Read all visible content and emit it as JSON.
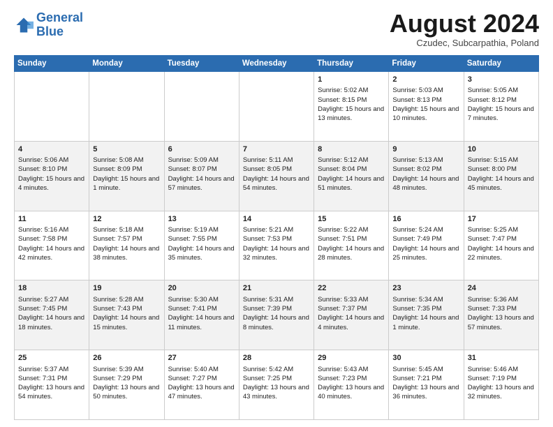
{
  "header": {
    "logo_line1": "General",
    "logo_line2": "Blue",
    "month": "August 2024",
    "location": "Czudec, Subcarpathia, Poland"
  },
  "days_of_week": [
    "Sunday",
    "Monday",
    "Tuesday",
    "Wednesday",
    "Thursday",
    "Friday",
    "Saturday"
  ],
  "weeks": [
    [
      {
        "day": "",
        "sunrise": "",
        "sunset": "",
        "daylight": ""
      },
      {
        "day": "",
        "sunrise": "",
        "sunset": "",
        "daylight": ""
      },
      {
        "day": "",
        "sunrise": "",
        "sunset": "",
        "daylight": ""
      },
      {
        "day": "",
        "sunrise": "",
        "sunset": "",
        "daylight": ""
      },
      {
        "day": "1",
        "sunrise": "Sunrise: 5:02 AM",
        "sunset": "Sunset: 8:15 PM",
        "daylight": "Daylight: 15 hours and 13 minutes."
      },
      {
        "day": "2",
        "sunrise": "Sunrise: 5:03 AM",
        "sunset": "Sunset: 8:13 PM",
        "daylight": "Daylight: 15 hours and 10 minutes."
      },
      {
        "day": "3",
        "sunrise": "Sunrise: 5:05 AM",
        "sunset": "Sunset: 8:12 PM",
        "daylight": "Daylight: 15 hours and 7 minutes."
      }
    ],
    [
      {
        "day": "4",
        "sunrise": "Sunrise: 5:06 AM",
        "sunset": "Sunset: 8:10 PM",
        "daylight": "Daylight: 15 hours and 4 minutes."
      },
      {
        "day": "5",
        "sunrise": "Sunrise: 5:08 AM",
        "sunset": "Sunset: 8:09 PM",
        "daylight": "Daylight: 15 hours and 1 minute."
      },
      {
        "day": "6",
        "sunrise": "Sunrise: 5:09 AM",
        "sunset": "Sunset: 8:07 PM",
        "daylight": "Daylight: 14 hours and 57 minutes."
      },
      {
        "day": "7",
        "sunrise": "Sunrise: 5:11 AM",
        "sunset": "Sunset: 8:05 PM",
        "daylight": "Daylight: 14 hours and 54 minutes."
      },
      {
        "day": "8",
        "sunrise": "Sunrise: 5:12 AM",
        "sunset": "Sunset: 8:04 PM",
        "daylight": "Daylight: 14 hours and 51 minutes."
      },
      {
        "day": "9",
        "sunrise": "Sunrise: 5:13 AM",
        "sunset": "Sunset: 8:02 PM",
        "daylight": "Daylight: 14 hours and 48 minutes."
      },
      {
        "day": "10",
        "sunrise": "Sunrise: 5:15 AM",
        "sunset": "Sunset: 8:00 PM",
        "daylight": "Daylight: 14 hours and 45 minutes."
      }
    ],
    [
      {
        "day": "11",
        "sunrise": "Sunrise: 5:16 AM",
        "sunset": "Sunset: 7:58 PM",
        "daylight": "Daylight: 14 hours and 42 minutes."
      },
      {
        "day": "12",
        "sunrise": "Sunrise: 5:18 AM",
        "sunset": "Sunset: 7:57 PM",
        "daylight": "Daylight: 14 hours and 38 minutes."
      },
      {
        "day": "13",
        "sunrise": "Sunrise: 5:19 AM",
        "sunset": "Sunset: 7:55 PM",
        "daylight": "Daylight: 14 hours and 35 minutes."
      },
      {
        "day": "14",
        "sunrise": "Sunrise: 5:21 AM",
        "sunset": "Sunset: 7:53 PM",
        "daylight": "Daylight: 14 hours and 32 minutes."
      },
      {
        "day": "15",
        "sunrise": "Sunrise: 5:22 AM",
        "sunset": "Sunset: 7:51 PM",
        "daylight": "Daylight: 14 hours and 28 minutes."
      },
      {
        "day": "16",
        "sunrise": "Sunrise: 5:24 AM",
        "sunset": "Sunset: 7:49 PM",
        "daylight": "Daylight: 14 hours and 25 minutes."
      },
      {
        "day": "17",
        "sunrise": "Sunrise: 5:25 AM",
        "sunset": "Sunset: 7:47 PM",
        "daylight": "Daylight: 14 hours and 22 minutes."
      }
    ],
    [
      {
        "day": "18",
        "sunrise": "Sunrise: 5:27 AM",
        "sunset": "Sunset: 7:45 PM",
        "daylight": "Daylight: 14 hours and 18 minutes."
      },
      {
        "day": "19",
        "sunrise": "Sunrise: 5:28 AM",
        "sunset": "Sunset: 7:43 PM",
        "daylight": "Daylight: 14 hours and 15 minutes."
      },
      {
        "day": "20",
        "sunrise": "Sunrise: 5:30 AM",
        "sunset": "Sunset: 7:41 PM",
        "daylight": "Daylight: 14 hours and 11 minutes."
      },
      {
        "day": "21",
        "sunrise": "Sunrise: 5:31 AM",
        "sunset": "Sunset: 7:39 PM",
        "daylight": "Daylight: 14 hours and 8 minutes."
      },
      {
        "day": "22",
        "sunrise": "Sunrise: 5:33 AM",
        "sunset": "Sunset: 7:37 PM",
        "daylight": "Daylight: 14 hours and 4 minutes."
      },
      {
        "day": "23",
        "sunrise": "Sunrise: 5:34 AM",
        "sunset": "Sunset: 7:35 PM",
        "daylight": "Daylight: 14 hours and 1 minute."
      },
      {
        "day": "24",
        "sunrise": "Sunrise: 5:36 AM",
        "sunset": "Sunset: 7:33 PM",
        "daylight": "Daylight: 13 hours and 57 minutes."
      }
    ],
    [
      {
        "day": "25",
        "sunrise": "Sunrise: 5:37 AM",
        "sunset": "Sunset: 7:31 PM",
        "daylight": "Daylight: 13 hours and 54 minutes."
      },
      {
        "day": "26",
        "sunrise": "Sunrise: 5:39 AM",
        "sunset": "Sunset: 7:29 PM",
        "daylight": "Daylight: 13 hours and 50 minutes."
      },
      {
        "day": "27",
        "sunrise": "Sunrise: 5:40 AM",
        "sunset": "Sunset: 7:27 PM",
        "daylight": "Daylight: 13 hours and 47 minutes."
      },
      {
        "day": "28",
        "sunrise": "Sunrise: 5:42 AM",
        "sunset": "Sunset: 7:25 PM",
        "daylight": "Daylight: 13 hours and 43 minutes."
      },
      {
        "day": "29",
        "sunrise": "Sunrise: 5:43 AM",
        "sunset": "Sunset: 7:23 PM",
        "daylight": "Daylight: 13 hours and 40 minutes."
      },
      {
        "day": "30",
        "sunrise": "Sunrise: 5:45 AM",
        "sunset": "Sunset: 7:21 PM",
        "daylight": "Daylight: 13 hours and 36 minutes."
      },
      {
        "day": "31",
        "sunrise": "Sunrise: 5:46 AM",
        "sunset": "Sunset: 7:19 PM",
        "daylight": "Daylight: 13 hours and 32 minutes."
      }
    ]
  ]
}
